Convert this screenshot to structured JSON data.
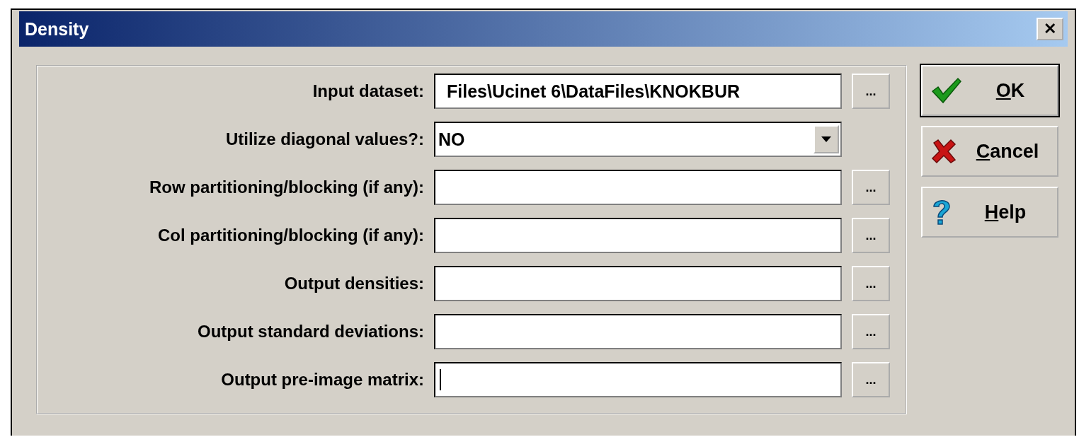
{
  "window": {
    "title": "Density",
    "close_label": "✕"
  },
  "rows": [
    {
      "kind": "file",
      "label": "Input dataset:",
      "value": "Files\\Ucinet 6\\DataFiles\\KNOKBUR",
      "focused": false,
      "browse_label": "..."
    },
    {
      "kind": "dropdown",
      "label": "Utilize diagonal values?:",
      "value": "NO",
      "focused": false
    },
    {
      "kind": "file",
      "label": "Row partitioning/blocking (if any):",
      "focused": false,
      "browse_label": "..."
    },
    {
      "kind": "file",
      "label": "Col partitioning/blocking (if any):",
      "focused": false,
      "browse_label": "..."
    },
    {
      "kind": "file",
      "label": "Output densities:",
      "focused": false,
      "browse_label": "..."
    },
    {
      "kind": "file",
      "label": "Output standard deviations:",
      "focused": false,
      "browse_label": "..."
    },
    {
      "kind": "file",
      "label": "Output pre-image matrix:",
      "focused": true,
      "browse_label": "..."
    }
  ],
  "buttons": [
    {
      "kind": "ok",
      "accel": "O",
      "rest": "K",
      "default": true
    },
    {
      "kind": "cancel",
      "accel": "C",
      "rest": "ancel",
      "default": false
    },
    {
      "kind": "help",
      "accel": "H",
      "rest": "elp",
      "default": false
    }
  ]
}
